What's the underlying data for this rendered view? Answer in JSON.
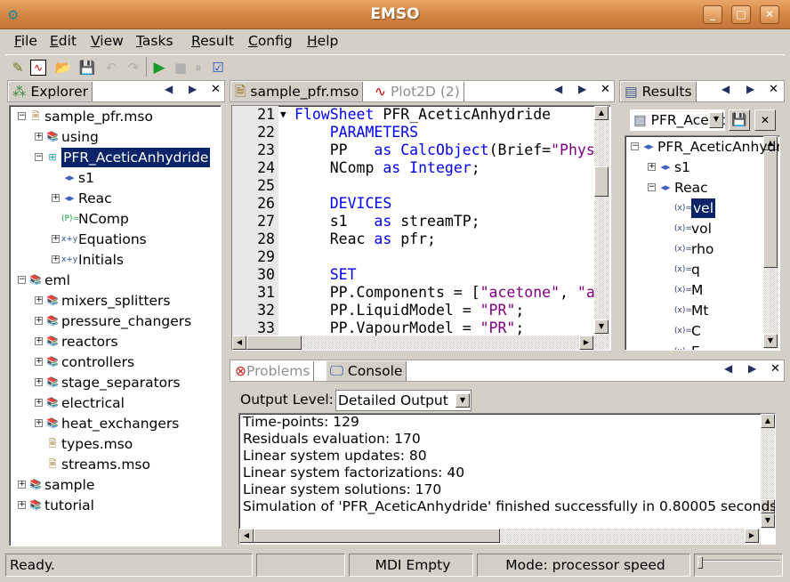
{
  "window": {
    "title": "EMSO",
    "buttons": [
      "_",
      "□",
      "✕"
    ]
  },
  "menu": [
    "File",
    "Edit",
    "View",
    "Tasks",
    "Result",
    "Config",
    "Help"
  ],
  "toolbar": {
    "icons": [
      "new-icon",
      "plot-icon",
      "open-icon",
      "save-icon",
      "undo-icon",
      "redo-icon",
      "run-icon",
      "stop-icon",
      "pause-icon",
      "check-icon"
    ]
  },
  "explorer": {
    "tab": "Explorer",
    "tree": [
      {
        "level": 0,
        "exp": "-",
        "icon": "file",
        "label": "sample_pfr.mso"
      },
      {
        "level": 1,
        "exp": "+",
        "icon": "lib",
        "label": "using"
      },
      {
        "level": 1,
        "exp": "-",
        "icon": "flowsheet",
        "label": "PFR_AceticAnhydride",
        "selected": true
      },
      {
        "level": 2,
        "exp": "",
        "icon": "device",
        "label": "s1"
      },
      {
        "level": 2,
        "exp": "+",
        "icon": "device",
        "label": "Reac"
      },
      {
        "level": 2,
        "exp": "",
        "icon": "param",
        "label": "NComp"
      },
      {
        "level": 2,
        "exp": "+",
        "icon": "eq",
        "label": "Equations"
      },
      {
        "level": 2,
        "exp": "+",
        "icon": "eq",
        "label": "Initials"
      },
      {
        "level": 0,
        "exp": "-",
        "icon": "lib",
        "label": "eml"
      },
      {
        "level": 1,
        "exp": "+",
        "icon": "lib",
        "label": "mixers_splitters"
      },
      {
        "level": 1,
        "exp": "+",
        "icon": "lib",
        "label": "pressure_changers"
      },
      {
        "level": 1,
        "exp": "+",
        "icon": "lib",
        "label": "reactors"
      },
      {
        "level": 1,
        "exp": "+",
        "icon": "lib",
        "label": "controllers"
      },
      {
        "level": 1,
        "exp": "+",
        "icon": "lib",
        "label": "stage_separators"
      },
      {
        "level": 1,
        "exp": "+",
        "icon": "lib",
        "label": "electrical"
      },
      {
        "level": 1,
        "exp": "+",
        "icon": "lib",
        "label": "heat_exchangers"
      },
      {
        "level": 1,
        "exp": "",
        "icon": "file",
        "label": "types.mso"
      },
      {
        "level": 1,
        "exp": "",
        "icon": "file",
        "label": "streams.mso"
      },
      {
        "level": 0,
        "exp": "+",
        "icon": "lib",
        "label": "sample"
      },
      {
        "level": 0,
        "exp": "+",
        "icon": "lib",
        "label": "tutorial"
      }
    ]
  },
  "editor": {
    "tabs": [
      "sample_pfr.mso",
      "Plot2D (2)"
    ],
    "lines": [
      {
        "n": "21",
        "fold": true,
        "t": [
          [
            "kw",
            "FlowSheet"
          ],
          [
            "",
            "PFR_AceticAnhydride"
          ]
        ],
        "sep": " "
      },
      {
        "n": "22",
        "t": [
          [
            "",
            "    "
          ],
          [
            "kw",
            "PARAMETERS"
          ]
        ]
      },
      {
        "n": "23",
        "t": [
          [
            "",
            "    PP   "
          ],
          [
            "kw",
            "as"
          ],
          [
            "",
            " "
          ],
          [
            "kw",
            "CalcObject"
          ],
          [
            "",
            "(Brief="
          ],
          [
            "str",
            "\"Phys"
          ]
        ]
      },
      {
        "n": "24",
        "t": [
          [
            "",
            "    NComp "
          ],
          [
            "kw",
            "as"
          ],
          [
            "",
            " "
          ],
          [
            "kw",
            "Integer"
          ],
          [
            "",
            ";"
          ]
        ]
      },
      {
        "n": "25",
        "t": []
      },
      {
        "n": "26",
        "t": [
          [
            "",
            "    "
          ],
          [
            "kw",
            "DEVICES"
          ]
        ]
      },
      {
        "n": "27",
        "t": [
          [
            "",
            "    s1   "
          ],
          [
            "kw",
            "as"
          ],
          [
            "",
            " streamTP;"
          ]
        ]
      },
      {
        "n": "28",
        "t": [
          [
            "",
            "    Reac "
          ],
          [
            "kw",
            "as"
          ],
          [
            "",
            " pfr;"
          ]
        ]
      },
      {
        "n": "29",
        "t": []
      },
      {
        "n": "30",
        "t": [
          [
            "",
            "    "
          ],
          [
            "kw",
            "SET"
          ]
        ]
      },
      {
        "n": "31",
        "t": [
          [
            "",
            "    PP.Components = ["
          ],
          [
            "str",
            "\"acetone\""
          ],
          [
            "",
            ", "
          ],
          [
            "str",
            "\"a"
          ]
        ]
      },
      {
        "n": "32",
        "t": [
          [
            "",
            "    PP.LiquidModel = "
          ],
          [
            "str",
            "\"PR\""
          ],
          [
            "",
            ";"
          ]
        ]
      },
      {
        "n": "33",
        "t": [
          [
            "",
            "    PP.VapourModel = "
          ],
          [
            "str",
            "\"PR\""
          ],
          [
            "",
            ";"
          ]
        ]
      }
    ]
  },
  "results": {
    "tab": "Results",
    "combo": "PFR_AceticAnhydride",
    "tree": [
      {
        "level": 0,
        "exp": "-",
        "icon": "device",
        "label": "PFR_AceticAnhydride"
      },
      {
        "level": 1,
        "exp": "+",
        "icon": "device",
        "label": "s1"
      },
      {
        "level": 1,
        "exp": "-",
        "icon": "device",
        "label": "Reac"
      },
      {
        "level": 2,
        "exp": "",
        "icon": "var",
        "label": "vel",
        "selected": true
      },
      {
        "level": 2,
        "exp": "",
        "icon": "var",
        "label": "vol"
      },
      {
        "level": 2,
        "exp": "",
        "icon": "var",
        "label": "rho"
      },
      {
        "level": 2,
        "exp": "",
        "icon": "var",
        "label": "q"
      },
      {
        "level": 2,
        "exp": "",
        "icon": "var",
        "label": "M"
      },
      {
        "level": 2,
        "exp": "",
        "icon": "var",
        "label": "Mt"
      },
      {
        "level": 2,
        "exp": "",
        "icon": "var",
        "label": "C"
      },
      {
        "level": 2,
        "exp": "",
        "icon": "var",
        "label": "E"
      }
    ]
  },
  "console": {
    "tabs": [
      "Problems",
      "Console"
    ],
    "output_level_label": "Output Level:",
    "output_level": "Detailed Output",
    "lines": [
      "Time-points: 129",
      "Residuals evaluation: 170",
      "Linear system updates: 80",
      "Linear system factorizations: 40",
      "Linear system solutions: 170",
      "Simulation of 'PFR_AceticAnhydride' finished successfully in 0.80005 seconds."
    ]
  },
  "status": {
    "message": "Ready.",
    "empty": "",
    "mdi": "MDI Empty",
    "mode": "Mode: processor speed"
  },
  "colors": {
    "titlebar": "#d1823f",
    "selection": "#0a246a",
    "keyword": "#0000ff",
    "string": "#800080"
  }
}
